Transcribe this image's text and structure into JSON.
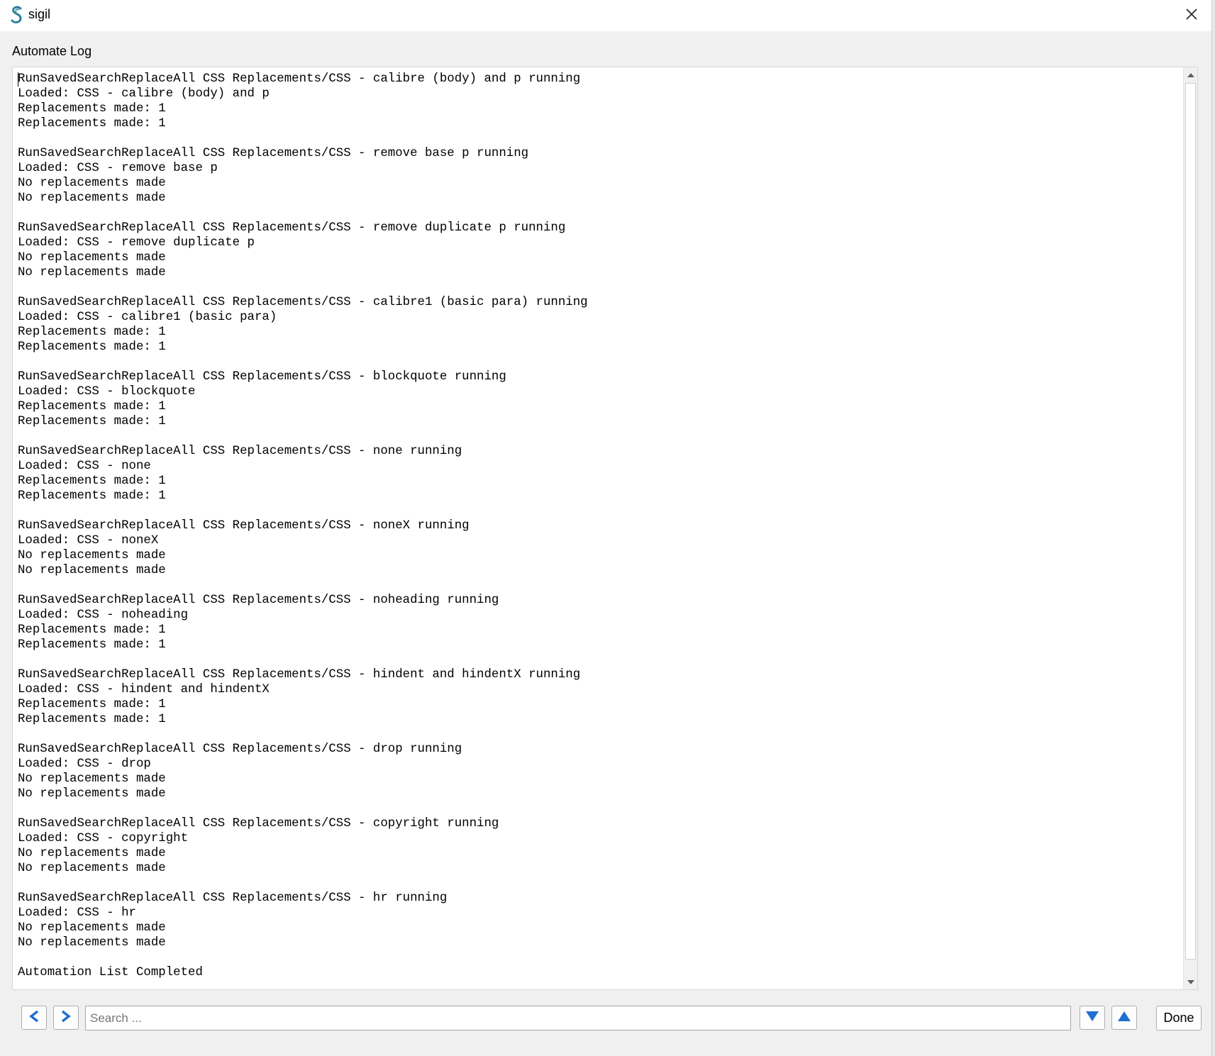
{
  "window": {
    "title": "sigil",
    "icons": {
      "app": "sigil-logo-icon",
      "close": "close-icon"
    }
  },
  "dialog": {
    "label": "Automate Log"
  },
  "log": {
    "lines": [
      "RunSavedSearchReplaceAll CSS Replacements/CSS - calibre (body) and p running",
      "Loaded: CSS - calibre (body) and p",
      "Replacements made: 1",
      "Replacements made: 1",
      "",
      "RunSavedSearchReplaceAll CSS Replacements/CSS - remove base p running",
      "Loaded: CSS - remove base p",
      "No replacements made",
      "No replacements made",
      "",
      "RunSavedSearchReplaceAll CSS Replacements/CSS - remove duplicate p running",
      "Loaded: CSS - remove duplicate p",
      "No replacements made",
      "No replacements made",
      "",
      "RunSavedSearchReplaceAll CSS Replacements/CSS - calibre1 (basic para) running",
      "Loaded: CSS - calibre1 (basic para)",
      "Replacements made: 1",
      "Replacements made: 1",
      "",
      "RunSavedSearchReplaceAll CSS Replacements/CSS - blockquote running",
      "Loaded: CSS - blockquote",
      "Replacements made: 1",
      "Replacements made: 1",
      "",
      "RunSavedSearchReplaceAll CSS Replacements/CSS - none running",
      "Loaded: CSS - none",
      "Replacements made: 1",
      "Replacements made: 1",
      "",
      "RunSavedSearchReplaceAll CSS Replacements/CSS - noneX running",
      "Loaded: CSS - noneX",
      "No replacements made",
      "No replacements made",
      "",
      "RunSavedSearchReplaceAll CSS Replacements/CSS - noheading running",
      "Loaded: CSS - noheading",
      "Replacements made: 1",
      "Replacements made: 1",
      "",
      "RunSavedSearchReplaceAll CSS Replacements/CSS - hindent and hindentX running",
      "Loaded: CSS - hindent and hindentX",
      "Replacements made: 1",
      "Replacements made: 1",
      "",
      "RunSavedSearchReplaceAll CSS Replacements/CSS - drop running",
      "Loaded: CSS - drop",
      "No replacements made",
      "No replacements made",
      "",
      "RunSavedSearchReplaceAll CSS Replacements/CSS - copyright running",
      "Loaded: CSS - copyright",
      "No replacements made",
      "No replacements made",
      "",
      "RunSavedSearchReplaceAll CSS Replacements/CSS - hr running",
      "Loaded: CSS - hr",
      "No replacements made",
      "No replacements made",
      "",
      "Automation List Completed"
    ],
    "icons": {
      "scroll_up": "scroll-up-arrow-icon",
      "scroll_down": "scroll-down-arrow-icon"
    }
  },
  "bottom_bar": {
    "prev_icon": "arrow-left-icon",
    "next_icon": "arrow-right-icon",
    "search": {
      "value": "",
      "placeholder": "Search ..."
    },
    "find_next_icon": "triangle-down-icon",
    "find_prev_icon": "triangle-up-icon",
    "done_label": "Done"
  },
  "colors": {
    "accent": "#1e6fd0",
    "logo": "#2a7f9e",
    "background": "#f0f0f0",
    "panel": "#ffffff"
  }
}
